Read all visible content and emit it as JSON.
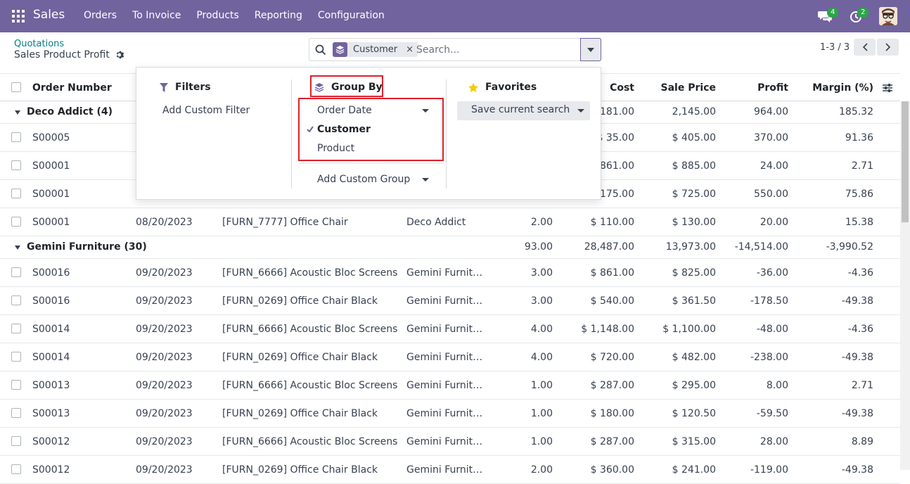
{
  "navbar": {
    "brand": "Sales",
    "menu": [
      "Orders",
      "To Invoice",
      "Products",
      "Reporting",
      "Configuration"
    ],
    "chat_count": "4",
    "activity_count": "2"
  },
  "breadcrumb": {
    "parent": "Quotations",
    "title": "Sales Product Profit"
  },
  "search": {
    "facet_label": "Customer",
    "facet_close": "×",
    "placeholder": "Search..."
  },
  "pager": {
    "text": "1-3 / 3"
  },
  "table": {
    "headers": {
      "order_number": "Order Number",
      "cost": "Cost",
      "sale_price": "Sale Price",
      "profit": "Profit",
      "margin": "Margin (%)"
    },
    "groups": [
      {
        "name": "Deco Addict (4)",
        "qty": "",
        "cost": ",181.00",
        "sale_price": "2,145.00",
        "profit": "964.00",
        "margin": "185.32",
        "rows": [
          {
            "order": "S00005",
            "date": "",
            "product": "",
            "customer": "",
            "qty": "",
            "cost": "$ 35.00",
            "sale_price": "$ 405.00",
            "profit": "370.00",
            "margin": "91.36"
          },
          {
            "order": "S00001",
            "date": "",
            "product": "",
            "customer": "",
            "qty": "",
            "cost": "861.00",
            "sale_price": "$ 885.00",
            "profit": "24.00",
            "margin": "2.71"
          },
          {
            "order": "S00001",
            "date": "",
            "product": "",
            "customer": "",
            "qty": "",
            "cost": "175.00",
            "sale_price": "$ 725.00",
            "profit": "550.00",
            "margin": "75.86"
          },
          {
            "order": "S00001",
            "date": "08/20/2023",
            "product": "[FURN_7777] Office Chair",
            "customer": "Deco Addict",
            "qty": "2.00",
            "cost": "$ 110.00",
            "sale_price": "$ 130.00",
            "profit": "20.00",
            "margin": "15.38"
          }
        ]
      },
      {
        "name": "Gemini Furniture (30)",
        "qty": "93.00",
        "cost": "28,487.00",
        "sale_price": "13,973.00",
        "profit": "-14,514.00",
        "margin": "-3,990.52",
        "rows": [
          {
            "order": "S00016",
            "date": "09/20/2023",
            "product": "[FURN_6666] Acoustic Bloc Screens",
            "customer": "Gemini Furnit…",
            "qty": "3.00",
            "cost": "$ 861.00",
            "sale_price": "$ 825.00",
            "profit": "-36.00",
            "margin": "-4.36"
          },
          {
            "order": "S00016",
            "date": "09/20/2023",
            "product": "[FURN_0269] Office Chair Black",
            "customer": "Gemini Furnit…",
            "qty": "3.00",
            "cost": "$ 540.00",
            "sale_price": "$ 361.50",
            "profit": "-178.50",
            "margin": "-49.38"
          },
          {
            "order": "S00014",
            "date": "09/20/2023",
            "product": "[FURN_6666] Acoustic Bloc Screens",
            "customer": "Gemini Furnit…",
            "qty": "4.00",
            "cost": "$ 1,148.00",
            "sale_price": "$ 1,100.00",
            "profit": "-48.00",
            "margin": "-4.36"
          },
          {
            "order": "S00014",
            "date": "09/20/2023",
            "product": "[FURN_0269] Office Chair Black",
            "customer": "Gemini Furnit…",
            "qty": "4.00",
            "cost": "$ 720.00",
            "sale_price": "$ 482.00",
            "profit": "-238.00",
            "margin": "-49.38"
          },
          {
            "order": "S00013",
            "date": "09/20/2023",
            "product": "[FURN_6666] Acoustic Bloc Screens",
            "customer": "Gemini Furnit…",
            "qty": "1.00",
            "cost": "$ 287.00",
            "sale_price": "$ 295.00",
            "profit": "8.00",
            "margin": "2.71"
          },
          {
            "order": "S00013",
            "date": "09/20/2023",
            "product": "[FURN_0269] Office Chair Black",
            "customer": "Gemini Furnit…",
            "qty": "1.00",
            "cost": "$ 180.00",
            "sale_price": "$ 120.50",
            "profit": "-59.50",
            "margin": "-49.38"
          },
          {
            "order": "S00012",
            "date": "09/20/2023",
            "product": "[FURN_6666] Acoustic Bloc Screens",
            "customer": "Gemini Furnit…",
            "qty": "1.00",
            "cost": "$ 287.00",
            "sale_price": "$ 315.00",
            "profit": "28.00",
            "margin": "8.89"
          },
          {
            "order": "S00012",
            "date": "09/20/2023",
            "product": "[FURN_0269] Office Chair Black",
            "customer": "Gemini Furnit…",
            "qty": "2.00",
            "cost": "$ 360.00",
            "sale_price": "$ 241.00",
            "profit": "-119.00",
            "margin": "-49.38"
          }
        ]
      }
    ]
  },
  "dropdown": {
    "filters": {
      "title": "Filters",
      "add_custom": "Add Custom Filter"
    },
    "group_by": {
      "title": "Group By",
      "options": [
        {
          "label": "Order Date",
          "selected": false,
          "has_submenu": true
        },
        {
          "label": "Customer",
          "selected": true,
          "has_submenu": false
        },
        {
          "label": "Product",
          "selected": false,
          "has_submenu": false
        }
      ],
      "add_custom": "Add Custom Group"
    },
    "favorites": {
      "title": "Favorites",
      "save": "Save current search"
    }
  },
  "colors": {
    "navbar": "#71639e",
    "highlight": "#e0202b",
    "link": "#017e84"
  }
}
